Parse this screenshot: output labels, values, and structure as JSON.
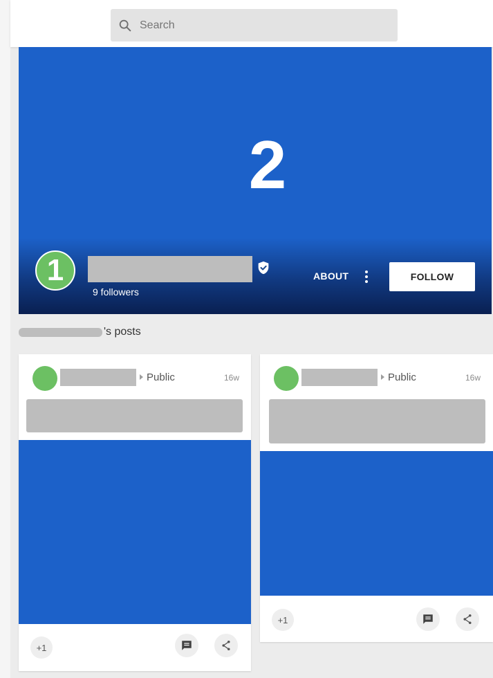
{
  "search": {
    "placeholder": "Search"
  },
  "profile": {
    "cover_badge": "2",
    "avatar_badge": "1",
    "followers": "9 followers",
    "about_label": "ABOUT",
    "follow_label": "FOLLOW"
  },
  "posts_section": {
    "suffix": "'s posts"
  },
  "posts": [
    {
      "visibility": "Public",
      "time": "16w",
      "plus_one": "+1"
    },
    {
      "visibility": "Public",
      "time": "16w",
      "plus_one": "+1"
    }
  ],
  "colors": {
    "cover": "#1c61c9",
    "avatar": "#6cc063",
    "redaction": "#bdbdbd",
    "background": "#ececec"
  },
  "icons": {
    "search": "search-icon",
    "verified": "verified-icon",
    "more": "more-vert-icon",
    "comment": "comment-icon",
    "share": "share-icon"
  }
}
